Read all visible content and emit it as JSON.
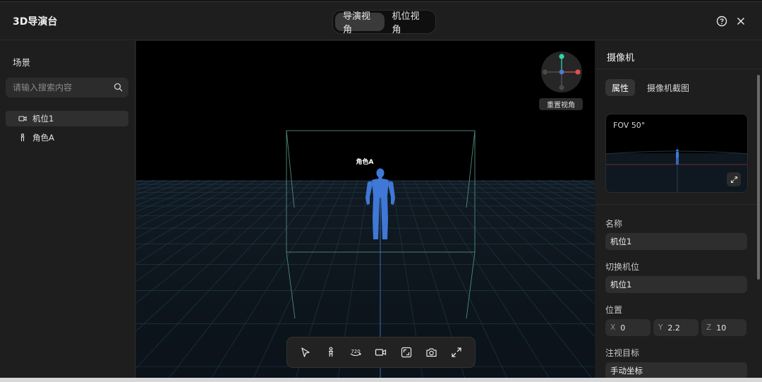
{
  "app": {
    "title": "3D导演台",
    "view_tabs": [
      {
        "label": "导演视角",
        "active": true
      },
      {
        "label": "机位视角",
        "active": false
      }
    ],
    "help_icon": "help-circle-icon",
    "close_icon": "close-icon"
  },
  "scene_panel": {
    "title": "场景",
    "search_placeholder": "请输入搜索内容",
    "items": [
      {
        "label": "机位1",
        "icon": "camera-icon",
        "selected": true
      },
      {
        "label": "角色A",
        "icon": "person-icon",
        "selected": false
      }
    ]
  },
  "viewport": {
    "reset_view_label": "重置视角",
    "character_label": "角色A",
    "tools": [
      "select-arrow-icon",
      "person-icon",
      "rotate-360-icon",
      "video-camera-icon",
      "fit-frame-icon",
      "screenshot-camera-icon",
      "fullscreen-icon"
    ],
    "colors": {
      "grid": "#1f3a4e",
      "frame": "#4f8a80",
      "character": "#3f78d6"
    }
  },
  "camera_panel": {
    "title": "摄像机",
    "tabs": [
      {
        "label": "属性",
        "active": true
      },
      {
        "label": "摄像机截图",
        "active": false
      }
    ],
    "preview_label": "FOV 50°",
    "name_label": "名称",
    "name_value": "机位1",
    "switch_label": "切换机位",
    "switch_value": "机位1",
    "position_label": "位置",
    "position": [
      {
        "axis": "X",
        "value": "0"
      },
      {
        "axis": "Y",
        "value": "2.2"
      },
      {
        "axis": "Z",
        "value": "10"
      }
    ],
    "target_label": "注视目标",
    "target_value": "手动坐标"
  }
}
